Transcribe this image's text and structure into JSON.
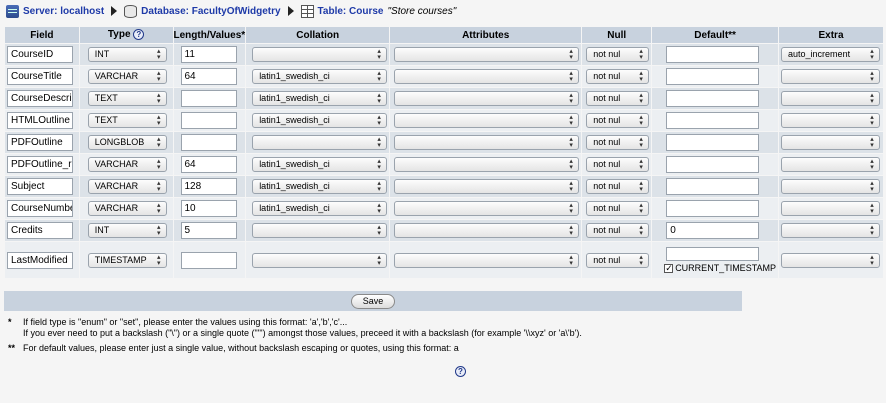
{
  "breadcrumb": {
    "server_label": "Server: localhost",
    "database_label": "Database: FacultyOfWidgetry",
    "table_label": "Table: Course",
    "table_comment": "\"Store courses\""
  },
  "headers": [
    "Field",
    "Type",
    "Length/Values*",
    "Collation",
    "Attributes",
    "Null",
    "Default**",
    "Extra"
  ],
  "rows": [
    {
      "field": "CourseID",
      "type": "INT",
      "length": "11",
      "collation": "",
      "attributes": "",
      "null": "not nul",
      "default": "",
      "extra": "auto_increment"
    },
    {
      "field": "CourseTitle",
      "type": "VARCHAR",
      "length": "64",
      "collation": "latin1_swedish_ci",
      "attributes": "",
      "null": "not nul",
      "default": "",
      "extra": ""
    },
    {
      "field": "CourseDescri",
      "type": "TEXT",
      "length": "",
      "collation": "latin1_swedish_ci",
      "attributes": "",
      "null": "not nul",
      "default": "",
      "extra": ""
    },
    {
      "field": "HTMLOutline",
      "type": "TEXT",
      "length": "",
      "collation": "latin1_swedish_ci",
      "attributes": "",
      "null": "not nul",
      "default": "",
      "extra": ""
    },
    {
      "field": "PDFOutline",
      "type": "LONGBLOB",
      "length": "",
      "collation": "",
      "attributes": "",
      "null": "not nul",
      "default": "",
      "extra": ""
    },
    {
      "field": "PDFOutline_r",
      "type": "VARCHAR",
      "length": "64",
      "collation": "latin1_swedish_ci",
      "attributes": "",
      "null": "not nul",
      "default": "",
      "extra": ""
    },
    {
      "field": "Subject",
      "type": "VARCHAR",
      "length": "128",
      "collation": "latin1_swedish_ci",
      "attributes": "",
      "null": "not nul",
      "default": "",
      "extra": ""
    },
    {
      "field": "CourseNumbe",
      "type": "VARCHAR",
      "length": "10",
      "collation": "latin1_swedish_ci",
      "attributes": "",
      "null": "not nul",
      "default": "",
      "extra": ""
    },
    {
      "field": "Credits",
      "type": "INT",
      "length": "5",
      "collation": "",
      "attributes": "",
      "null": "not nul",
      "default": "0",
      "extra": ""
    },
    {
      "field": "LastModified",
      "type": "TIMESTAMP",
      "length": "",
      "collation": "",
      "attributes": "",
      "null": "not nul",
      "default": "",
      "extra": "",
      "current_timestamp_label": "CURRENT_TIMESTAMP",
      "current_timestamp_checked": true
    }
  ],
  "type_help_icon": "question-icon",
  "save_label": "Save",
  "notes": {
    "mark1": "*",
    "line1a": "If field type is \"enum\" or \"set\", please enter the values using this format: 'a','b','c'...",
    "line1b": "If you ever need to put a backslash (\"\\\") or a single quote (\"'\") amongst those values, preceed it with a backslash (for example '\\\\xyz' or 'a\\'b').",
    "mark2": "**",
    "line2": "For default values, please enter just a single value, without backslash escaping or quotes, using this format: a"
  },
  "colors": {
    "header_bg": "#c8d2de",
    "row_odd": "#dce2e8",
    "row_even": "#eceff2",
    "link": "#1e3aa8"
  }
}
